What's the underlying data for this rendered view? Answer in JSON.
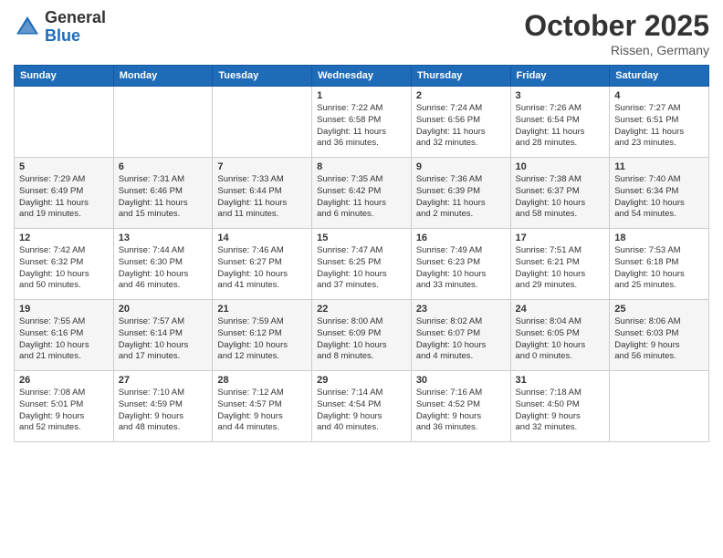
{
  "header": {
    "logo_general": "General",
    "logo_blue": "Blue",
    "month_title": "October 2025",
    "location": "Rissen, Germany"
  },
  "days_of_week": [
    "Sunday",
    "Monday",
    "Tuesday",
    "Wednesday",
    "Thursday",
    "Friday",
    "Saturday"
  ],
  "weeks": [
    [
      {
        "day": "",
        "info": ""
      },
      {
        "day": "",
        "info": ""
      },
      {
        "day": "",
        "info": ""
      },
      {
        "day": "1",
        "info": "Sunrise: 7:22 AM\nSunset: 6:58 PM\nDaylight: 11 hours\nand 36 minutes."
      },
      {
        "day": "2",
        "info": "Sunrise: 7:24 AM\nSunset: 6:56 PM\nDaylight: 11 hours\nand 32 minutes."
      },
      {
        "day": "3",
        "info": "Sunrise: 7:26 AM\nSunset: 6:54 PM\nDaylight: 11 hours\nand 28 minutes."
      },
      {
        "day": "4",
        "info": "Sunrise: 7:27 AM\nSunset: 6:51 PM\nDaylight: 11 hours\nand 23 minutes."
      }
    ],
    [
      {
        "day": "5",
        "info": "Sunrise: 7:29 AM\nSunset: 6:49 PM\nDaylight: 11 hours\nand 19 minutes."
      },
      {
        "day": "6",
        "info": "Sunrise: 7:31 AM\nSunset: 6:46 PM\nDaylight: 11 hours\nand 15 minutes."
      },
      {
        "day": "7",
        "info": "Sunrise: 7:33 AM\nSunset: 6:44 PM\nDaylight: 11 hours\nand 11 minutes."
      },
      {
        "day": "8",
        "info": "Sunrise: 7:35 AM\nSunset: 6:42 PM\nDaylight: 11 hours\nand 6 minutes."
      },
      {
        "day": "9",
        "info": "Sunrise: 7:36 AM\nSunset: 6:39 PM\nDaylight: 11 hours\nand 2 minutes."
      },
      {
        "day": "10",
        "info": "Sunrise: 7:38 AM\nSunset: 6:37 PM\nDaylight: 10 hours\nand 58 minutes."
      },
      {
        "day": "11",
        "info": "Sunrise: 7:40 AM\nSunset: 6:34 PM\nDaylight: 10 hours\nand 54 minutes."
      }
    ],
    [
      {
        "day": "12",
        "info": "Sunrise: 7:42 AM\nSunset: 6:32 PM\nDaylight: 10 hours\nand 50 minutes."
      },
      {
        "day": "13",
        "info": "Sunrise: 7:44 AM\nSunset: 6:30 PM\nDaylight: 10 hours\nand 46 minutes."
      },
      {
        "day": "14",
        "info": "Sunrise: 7:46 AM\nSunset: 6:27 PM\nDaylight: 10 hours\nand 41 minutes."
      },
      {
        "day": "15",
        "info": "Sunrise: 7:47 AM\nSunset: 6:25 PM\nDaylight: 10 hours\nand 37 minutes."
      },
      {
        "day": "16",
        "info": "Sunrise: 7:49 AM\nSunset: 6:23 PM\nDaylight: 10 hours\nand 33 minutes."
      },
      {
        "day": "17",
        "info": "Sunrise: 7:51 AM\nSunset: 6:21 PM\nDaylight: 10 hours\nand 29 minutes."
      },
      {
        "day": "18",
        "info": "Sunrise: 7:53 AM\nSunset: 6:18 PM\nDaylight: 10 hours\nand 25 minutes."
      }
    ],
    [
      {
        "day": "19",
        "info": "Sunrise: 7:55 AM\nSunset: 6:16 PM\nDaylight: 10 hours\nand 21 minutes."
      },
      {
        "day": "20",
        "info": "Sunrise: 7:57 AM\nSunset: 6:14 PM\nDaylight: 10 hours\nand 17 minutes."
      },
      {
        "day": "21",
        "info": "Sunrise: 7:59 AM\nSunset: 6:12 PM\nDaylight: 10 hours\nand 12 minutes."
      },
      {
        "day": "22",
        "info": "Sunrise: 8:00 AM\nSunset: 6:09 PM\nDaylight: 10 hours\nand 8 minutes."
      },
      {
        "day": "23",
        "info": "Sunrise: 8:02 AM\nSunset: 6:07 PM\nDaylight: 10 hours\nand 4 minutes."
      },
      {
        "day": "24",
        "info": "Sunrise: 8:04 AM\nSunset: 6:05 PM\nDaylight: 10 hours\nand 0 minutes."
      },
      {
        "day": "25",
        "info": "Sunrise: 8:06 AM\nSunset: 6:03 PM\nDaylight: 9 hours\nand 56 minutes."
      }
    ],
    [
      {
        "day": "26",
        "info": "Sunrise: 7:08 AM\nSunset: 5:01 PM\nDaylight: 9 hours\nand 52 minutes."
      },
      {
        "day": "27",
        "info": "Sunrise: 7:10 AM\nSunset: 4:59 PM\nDaylight: 9 hours\nand 48 minutes."
      },
      {
        "day": "28",
        "info": "Sunrise: 7:12 AM\nSunset: 4:57 PM\nDaylight: 9 hours\nand 44 minutes."
      },
      {
        "day": "29",
        "info": "Sunrise: 7:14 AM\nSunset: 4:54 PM\nDaylight: 9 hours\nand 40 minutes."
      },
      {
        "day": "30",
        "info": "Sunrise: 7:16 AM\nSunset: 4:52 PM\nDaylight: 9 hours\nand 36 minutes."
      },
      {
        "day": "31",
        "info": "Sunrise: 7:18 AM\nSunset: 4:50 PM\nDaylight: 9 hours\nand 32 minutes."
      },
      {
        "day": "",
        "info": ""
      }
    ]
  ]
}
